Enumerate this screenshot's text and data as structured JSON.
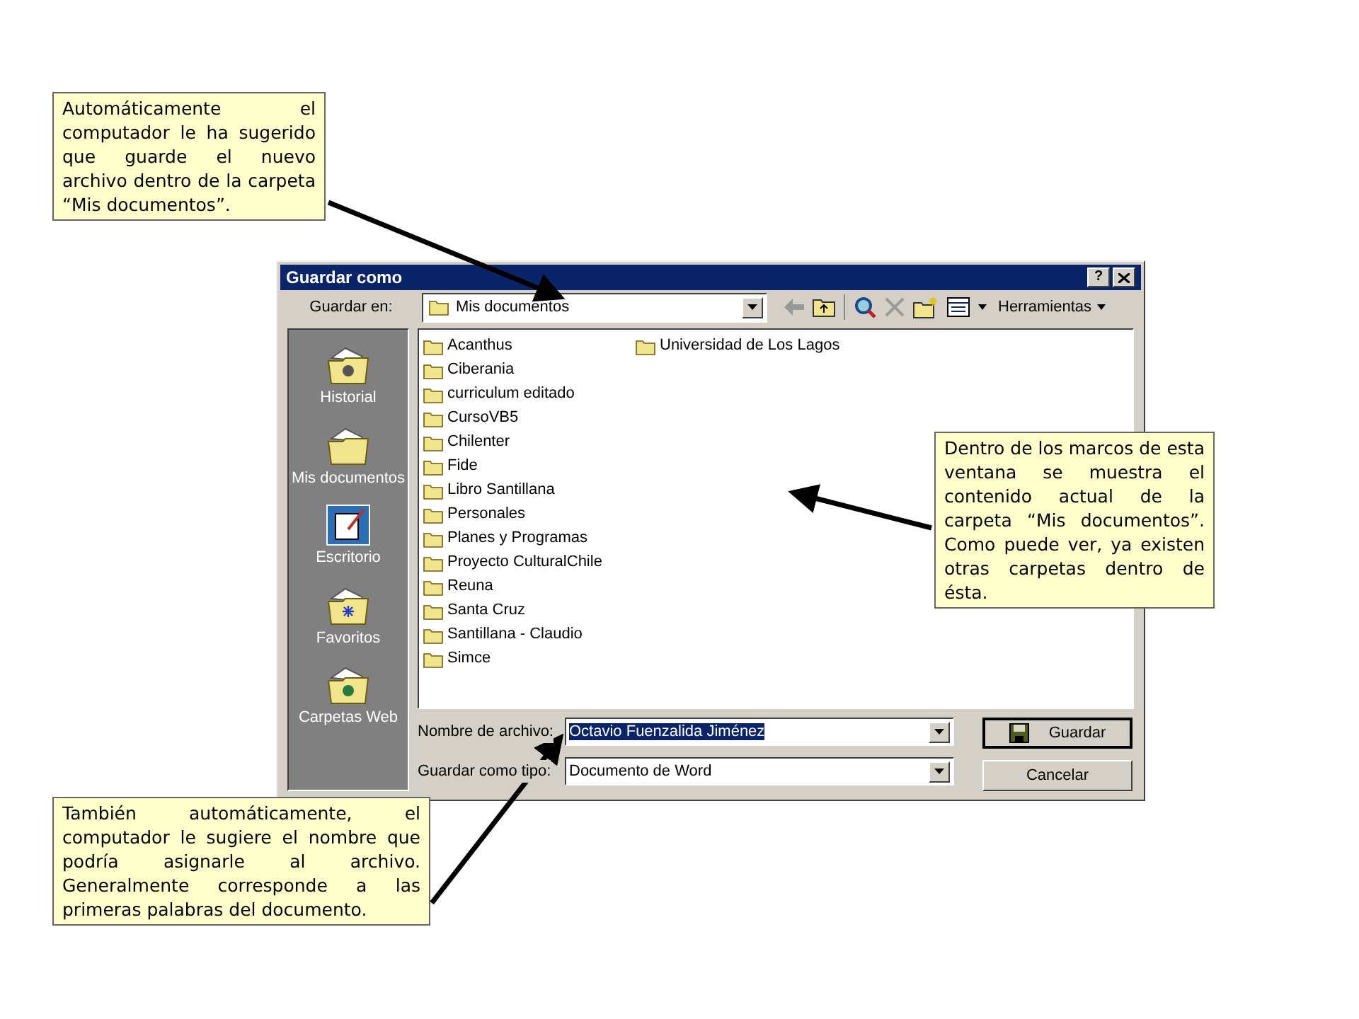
{
  "callouts": [
    {
      "text": "Automáticamente el computador le ha sugerido que guarde el nuevo archivo dentro de la carpeta “Mis documentos”."
    },
    {
      "text": "Dentro de los marcos de esta ventana se muestra el contenido actual de la carpeta “Mis documentos”. Como puede ver, ya existen otras carpetas dentro de ésta."
    },
    {
      "text": "También automáticamente, el computador le sugiere el nombre que podría asignarle al archivo. Generalmente corresponde a las primeras palabras del documento."
    }
  ],
  "dialog": {
    "title": "Guardar como",
    "help": "?",
    "save_in": {
      "label": "Guardar en:",
      "value": "Mis documentos"
    },
    "tools_menu": "Herramientas",
    "places": [
      {
        "label": "Historial",
        "kind": "history"
      },
      {
        "label": "Mis documentos",
        "kind": "documents"
      },
      {
        "label": "Escritorio",
        "kind": "desktop"
      },
      {
        "label": "Favoritos",
        "kind": "favorites"
      },
      {
        "label": "Carpetas Web",
        "kind": "web"
      }
    ],
    "files": [
      {
        "name": "Acanthus"
      },
      {
        "name": "Ciberania"
      },
      {
        "name": "curriculum editado"
      },
      {
        "name": "CursoVB5"
      },
      {
        "name": "Chilenter"
      },
      {
        "name": "Fide"
      },
      {
        "name": "Libro Santillana"
      },
      {
        "name": "Personales"
      },
      {
        "name": "Planes y Programas"
      },
      {
        "name": "Proyecto CulturalChile"
      },
      {
        "name": "Reuna"
      },
      {
        "name": "Santa Cruz"
      },
      {
        "name": "Santillana - Claudio"
      },
      {
        "name": "Simce"
      },
      {
        "name": "Universidad de Los Lagos"
      }
    ],
    "file_name": {
      "label": "Nombre de archivo:",
      "value": "Octavio Fuenzalida Jiménez",
      "highlighted": true
    },
    "file_type": {
      "label": "Guardar como tipo:",
      "value": "Documento de Word"
    },
    "buttons": [
      {
        "label": "Guardar",
        "kind": "save",
        "default": true
      },
      {
        "label": "Cancelar",
        "kind": "cancel",
        "default": false
      }
    ]
  }
}
